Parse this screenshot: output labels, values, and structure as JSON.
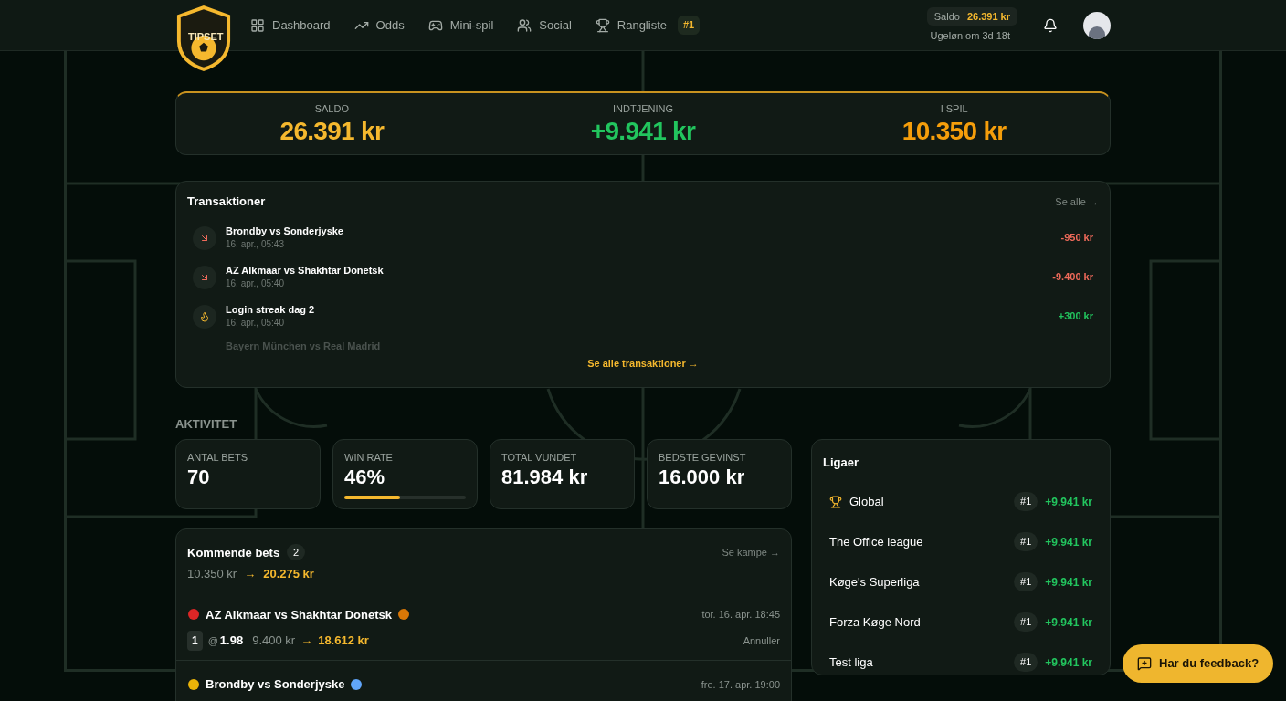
{
  "logo": {
    "text": "TIPSET"
  },
  "nav": [
    {
      "label": "Dashboard",
      "selected": false
    },
    {
      "label": "Odds",
      "selected": false
    },
    {
      "label": "Mini-spil",
      "selected": false
    },
    {
      "label": "Social",
      "selected": false
    },
    {
      "label": "Rangliste",
      "selected": false,
      "badge": "#1"
    }
  ],
  "balance": {
    "label": "Saldo",
    "value": "26.391 kr",
    "note": "Ugeløn om 3d 18t"
  },
  "summary": [
    {
      "label": "SALDO",
      "value": "26.391 kr",
      "color": "#f5b82e"
    },
    {
      "label": "INDTJENING",
      "value": "+9.941 kr",
      "color": "#22c55e"
    },
    {
      "label": "I SPIL",
      "value": "10.350 kr",
      "color": "#f59e0b"
    }
  ],
  "transactions": {
    "title": "Transaktioner",
    "see_all": "Se alle →",
    "footer_link": "Se alle transaktioner →",
    "rows": [
      {
        "kind": "loss",
        "title": "Brondby vs Sonderjyske",
        "time": "16. apr., 05:43",
        "amount": "-950 kr"
      },
      {
        "kind": "loss",
        "title": "AZ Alkmaar vs Shakhtar Donetsk",
        "time": "16. apr., 05:40",
        "amount": "-9.400 kr"
      },
      {
        "kind": "streak",
        "title": "Login streak dag 2",
        "time": "16. apr., 05:40",
        "amount": "+300 kr"
      },
      {
        "kind": "faded",
        "title": "Bayern München vs Real Madrid"
      }
    ]
  },
  "activity": {
    "heading": "AKTIVITET",
    "cards": [
      {
        "label": "ANTAL BETS",
        "value": "70"
      },
      {
        "label": "WIN RATE",
        "value": "46%",
        "level": 0.46
      },
      {
        "label": "TOTAL VUNDET",
        "value": "81.984 kr"
      },
      {
        "label": "BEDSTE GEVINST",
        "value": "16.000 kr"
      }
    ]
  },
  "upcoming": {
    "title": "Kommende bets",
    "count": "2",
    "link": "Se kampe →",
    "stake_total": "10.350 kr",
    "arrow": "→",
    "payout_total": "20.275 kr",
    "bets": [
      {
        "match": "AZ Alkmaar vs Shakhtar Donetsk",
        "date": "tor. 16. apr. 18:45",
        "pick": "1",
        "at": "@",
        "odds": "1.98",
        "stake": "9.400 kr",
        "arrow": "→",
        "payout": "18.612 kr",
        "cancel": "Annuller"
      },
      {
        "match": "Brondby vs Sonderjyske",
        "date": "fre. 17. apr. 19:00"
      }
    ]
  },
  "leagues": {
    "title": "Ligaer",
    "rows": [
      {
        "name": "Global",
        "trophy": true,
        "rank": "#1",
        "gain": "+9.941 kr"
      },
      {
        "name": "The Office league",
        "trophy": false,
        "rank": "#1",
        "gain": "+9.941 kr"
      },
      {
        "name": "Køge's Superliga",
        "trophy": false,
        "rank": "#1",
        "gain": "+9.941 kr"
      },
      {
        "name": "Forza Køge Nord",
        "trophy": false,
        "rank": "#1",
        "gain": "+9.941 kr"
      },
      {
        "name": "Test liga",
        "trophy": false,
        "rank": "#1",
        "gain": "+9.941 kr"
      }
    ]
  },
  "feedback": {
    "label": "Har du feedback?"
  }
}
